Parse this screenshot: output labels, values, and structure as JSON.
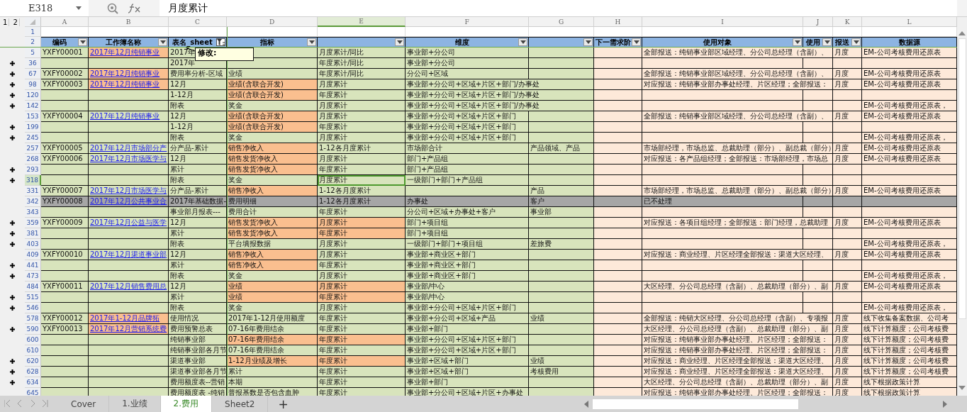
{
  "formula_bar": {
    "cell_name": "E318",
    "value": "月度累计"
  },
  "outline_levels": [
    "1",
    "2"
  ],
  "columns": [
    {
      "letter": "A",
      "header": "编码",
      "filter": true,
      "filter_active": false,
      "selected": false
    },
    {
      "letter": "B",
      "header": "工作簿名称",
      "filter": true,
      "filter_active": false,
      "selected": false
    },
    {
      "letter": "C",
      "header": "表名_sheet",
      "filter": true,
      "filter_active": true,
      "selected": false
    },
    {
      "letter": "D",
      "header": "指标",
      "filter": true,
      "filter_active": false,
      "selected": false
    },
    {
      "letter": "E",
      "filter": true,
      "filter_active": false,
      "selected": true
    },
    {
      "letter": "F",
      "header": "维度",
      "filter": true,
      "filter_active": false,
      "selected": false
    },
    {
      "letter": "G",
      "filter": true,
      "filter_active": false,
      "selected": false
    },
    {
      "letter": "H",
      "header": "下一需求阶",
      "filter": true,
      "filter_active": false,
      "selected": false
    },
    {
      "letter": "I",
      "header": "使用对象",
      "filter": true,
      "filter_active": false,
      "selected": false
    },
    {
      "letter": "J",
      "header": "使用",
      "filter": true,
      "filter_active": false,
      "selected": false
    },
    {
      "letter": "K",
      "header": "报送",
      "filter": true,
      "filter_active": false,
      "selected": false
    },
    {
      "letter": "L",
      "header": "数据源",
      "filter": false,
      "selected": false
    }
  ],
  "title_row_number": "1",
  "header_row_number": "2",
  "rows": [
    {
      "row": "5",
      "expand": false,
      "selected": false,
      "kind": "normal",
      "highlight": {
        "B": true
      },
      "cells": {
        "A": "YXFY00001",
        "B": "2017年12月纯销事业",
        "C": "2017年",
        "E": "月度累计/同比",
        "F": "事业部+分公司",
        "I": "全部报送：纯销事业部区域经理、分公司总经理（含副）、",
        "K": "月度",
        "L": "EM-公司考核费用还原表"
      }
    },
    {
      "row": "36",
      "expand": true,
      "selected": false,
      "kind": "normal",
      "highlight": {},
      "cells": {
        "C": "2017年",
        "E": "年度累计/同比",
        "F": "事业部+分公司"
      }
    },
    {
      "row": "67",
      "expand": true,
      "selected": false,
      "kind": "normal",
      "highlight": {
        "B": true
      },
      "cells": {
        "A": "YXFY00002",
        "B": "2017年12月纯销事业",
        "C": "费用率分析-区域",
        "D": "业绩",
        "E": "年度累计/同比",
        "F": "分公司+区域",
        "I": "全部报送：纯销事业部区域经理、分公司总经理（含副）、",
        "K": "月度",
        "L": "EM-公司考核费用还原表"
      }
    },
    {
      "row": "98",
      "expand": true,
      "selected": false,
      "kind": "normal",
      "highlight": {
        "B": true,
        "D": true
      },
      "cells": {
        "A": "YXFY00003",
        "B": "2017年12月纯销事业",
        "C": "12月",
        "D": "业绩(含联合开发)",
        "E": "月度累计",
        "F": "事业部+分公司+区域+片区+部门/办事处",
        "I": "对应报送：纯销事业部办事处经理、片区经理；全部报送：",
        "K": "月度",
        "L": "EM-公司考核费用还原表"
      }
    },
    {
      "row": "120",
      "expand": true,
      "selected": false,
      "kind": "normal",
      "highlight": {
        "D": true
      },
      "cells": {
        "C": "1-12月",
        "D": "业绩(含联合开发)",
        "E": "年度累计",
        "F": "事业部+分公司+区域+片区+部门/办事处"
      }
    },
    {
      "row": "142",
      "expand": true,
      "selected": false,
      "kind": "normal",
      "highlight": {},
      "cells": {
        "C": "附表",
        "D": "奖金",
        "E": "月度累计",
        "F": "事业部+分公司+区域+片区+部门/办事处",
        "L": "EM-公司考核费用还原表，"
      }
    },
    {
      "row": "153",
      "expand": false,
      "selected": false,
      "kind": "normal",
      "highlight": {
        "D": true
      },
      "cells": {
        "A": "YXFY00004",
        "B": "2017年12月纯销事业",
        "C": "12月",
        "D": "业绩(含联合开发)",
        "E": "月度累计",
        "F": "事业部+分公司+区域+片区+部门",
        "I": "全部报送：纯销事业部区域经理、分公司总经理（含副）、",
        "K": "月度",
        "L": "EM-公司考核费用还原表"
      }
    },
    {
      "row": "199",
      "expand": true,
      "selected": false,
      "kind": "normal",
      "highlight": {
        "D": true
      },
      "cells": {
        "C": "1-12月",
        "D": "业绩(含联合开发)",
        "E": "年度累计",
        "F": "事业部+分公司+区域+片区+部门"
      }
    },
    {
      "row": "245",
      "expand": true,
      "selected": false,
      "kind": "normal",
      "highlight": {},
      "cells": {
        "C": "附表",
        "D": "奖金",
        "E": "月度累计",
        "F": "事业部+分公司+区域+片区+部门",
        "L": "EM-公司考核费用还原表，"
      }
    },
    {
      "row": "257",
      "expand": false,
      "selected": false,
      "kind": "normal",
      "highlight": {
        "D": true
      },
      "cells": {
        "A": "YXFY00005",
        "B": "2017年12月市场部分产",
        "C": "分产品-累计",
        "D": "销售净收入",
        "E": "1-12各月度累计",
        "F": "市场部合计",
        "G": "产品领域、产品",
        "I": "市场部经理，市场总监、总裁助理（部分）、副总裁（部分）",
        "K": "月度",
        "L": "EM-公司考核费用还原表"
      }
    },
    {
      "row": "268",
      "expand": false,
      "selected": false,
      "kind": "normal",
      "highlight": {
        "D": true
      },
      "cells": {
        "A": "YXFY00006",
        "B": "2017年12月市场医学与",
        "C": "12月",
        "D": "销售发货净收入",
        "E": "月度累计",
        "F": "部门+产品组",
        "I": "对应报送：各产品组经理；全部报送：市场部经理，市场总",
        "K": "月度",
        "L": "EM-公司考核费用还原表"
      }
    },
    {
      "row": "293",
      "expand": true,
      "selected": false,
      "kind": "normal",
      "highlight": {
        "D": true
      },
      "cells": {
        "C": "累计",
        "D": "销售发货净收入",
        "E": "年度累计",
        "F": "部门+产品组"
      }
    },
    {
      "row": "318",
      "expand": true,
      "selected": true,
      "kind": "normal",
      "highlight": {},
      "cells": {
        "C": "附表",
        "D": "奖金",
        "E": "月度累计",
        "F": "一级部门+部门+产品组"
      }
    },
    {
      "row": "331",
      "expand": false,
      "selected": false,
      "kind": "normal",
      "highlight": {
        "D": true
      },
      "cells": {
        "A": "YXFY00007",
        "B": "2017年12月市场医学与",
        "C": "分产品-累计",
        "D": "销售净收入",
        "E": "1-12各月度累计",
        "G": "产品",
        "I": "市场部经理，市场总监、总裁助理（部分）、副总裁（部分）",
        "K": "月度",
        "L": "EM-公司考核费用还原表"
      }
    },
    {
      "row": "342",
      "expand": false,
      "selected": false,
      "kind": "gray",
      "highlight": {},
      "cells": {
        "A": "YXFY00008",
        "B": "2017年12月公共事业合",
        "C": "2017年基础数据-",
        "D": "费用明细",
        "E": "1-12各月度累计",
        "F": "办事处",
        "G": "客户",
        "I": "已不处理"
      }
    },
    {
      "row": "343",
      "expand": false,
      "selected": false,
      "kind": "normal",
      "highlight": {},
      "cells": {
        "C": "事业部月报表---",
        "D": "费用合计",
        "E": "年度累计",
        "F": "分公司+区域+办事处+客户",
        "G": "事业部"
      }
    },
    {
      "row": "359",
      "expand": true,
      "selected": false,
      "kind": "normal",
      "highlight": {
        "D": true,
        "E": true
      },
      "cells": {
        "A": "YXFY00009",
        "B": "2017年12月公益与医学",
        "C": "12月",
        "D": "销售发货净收入",
        "E": "月度累计",
        "F": "部门+项目组",
        "I": "对应报送：各项目组经理；全部报送：部门经理，总裁助理",
        "K": "月度",
        "L": "EM-公司考核费用还原表"
      }
    },
    {
      "row": "381",
      "expand": true,
      "selected": false,
      "kind": "normal",
      "highlight": {
        "D": true,
        "E": true
      },
      "cells": {
        "C": "累计",
        "D": "销售发货净收入",
        "E": "年度累计",
        "F": "部门+项目组"
      }
    },
    {
      "row": "403",
      "expand": true,
      "selected": false,
      "kind": "normal",
      "highlight": {},
      "cells": {
        "C": "附表",
        "D": "平台填报数据",
        "E": "月度累计",
        "F": "一级部门+部门+项目组",
        "G": "差旅费",
        "L": "EM-公司考核费用还原表，"
      }
    },
    {
      "row": "409",
      "expand": false,
      "selected": false,
      "kind": "normal",
      "highlight": {
        "D": true
      },
      "cells": {
        "A": "YXFY00010",
        "B": "2017年12月渠道事业部",
        "C": "12月",
        "D": "销售净收入",
        "E": "月度累计",
        "F": "事业部+商业区+部门",
        "I": "对应报送：商业经理、片区经理全部报送：渠道大区经理、",
        "K": "月度",
        "L": "EM-公司考核费用还原表"
      }
    },
    {
      "row": "441",
      "expand": true,
      "selected": false,
      "kind": "normal",
      "highlight": {
        "D": true
      },
      "cells": {
        "C": "累计",
        "D": "销售净收入",
        "E": "年度累计",
        "F": "事业部+商业区+部门"
      }
    },
    {
      "row": "473",
      "expand": true,
      "selected": false,
      "kind": "normal",
      "highlight": {},
      "cells": {
        "C": "附表",
        "D": "奖金",
        "E": "月度累计",
        "F": "事业部+商业区+部门",
        "L": "EM-公司考核费用还原表，"
      }
    },
    {
      "row": "484",
      "expand": false,
      "selected": false,
      "kind": "normal",
      "highlight": {
        "D": true,
        "E": true
      },
      "cells": {
        "A": "YXFY00011",
        "B": "2017年12月销售费用总",
        "C": "12月",
        "D": "业绩",
        "E": "月度累计",
        "F": "事业部/中心",
        "I": "大区经理、分公司总经理（含副）、总裁助理（部分）、副",
        "K": "月度",
        "L": "EM-公司考核费用还原表"
      }
    },
    {
      "row": "515",
      "expand": true,
      "selected": false,
      "kind": "normal",
      "highlight": {
        "D": true,
        "E": true
      },
      "cells": {
        "C": "累计",
        "D": "业绩",
        "E": "年度累计",
        "F": "事业部/中心"
      }
    },
    {
      "row": "546",
      "expand": true,
      "selected": false,
      "kind": "normal",
      "highlight": {},
      "cells": {
        "C": "附表",
        "D": "奖金",
        "E": "月度累计",
        "F": "事业部+分公司+区域+片区+部门",
        "L": "EM-公司考核费用还原表，"
      }
    },
    {
      "row": "578",
      "expand": false,
      "selected": false,
      "kind": "normal",
      "highlight": {
        "B": true
      },
      "cells": {
        "A": "YXFY00012",
        "B": "2017年1-12月品牌拓",
        "C": "使用情况",
        "D": "2017年1-12月使用额度",
        "E": "年度累计",
        "F": "事业部+分公司+区域+产品",
        "G": "业绩",
        "I": "全部报送：纯销大区经理、分公司总经理（含副）、专项报",
        "K": "月度",
        "L": "线下收集备案数据、公司考"
      }
    },
    {
      "row": "590",
      "expand": true,
      "selected": false,
      "kind": "normal",
      "highlight": {
        "B": true
      },
      "cells": {
        "A": "YXFY00013",
        "B": "2017年12月营销系统费",
        "C": "费用预警总表",
        "D": "07-16年费用结余",
        "E": "年度累计",
        "F": "事业部+部门",
        "I": "大区经理、分公司总经理（含副）、总裁助理（部分）、副",
        "K": "月度",
        "L": "线下计算额度；公司考核费"
      }
    },
    {
      "row": "600",
      "expand": false,
      "selected": false,
      "kind": "normal",
      "highlight": {
        "D": true,
        "E": true
      },
      "cells": {
        "C": "纯销事业部",
        "D": "07-16年费用结余",
        "E": "年度累计",
        "F": "事业部+分公司+区域+片区+部门",
        "I": "对应报送：纯销事业部办事处经理、片区经理；全部报送：",
        "K": "月度",
        "L": "线下计算额度；公司考核费"
      }
    },
    {
      "row": "610",
      "expand": false,
      "selected": false,
      "kind": "normal",
      "highlight": {},
      "cells": {
        "C": "纯销事业部各月节",
        "D": "07-16年费用结余",
        "E": "年度累计",
        "F": "事业部+分公司+区域+片区+部门",
        "I": "对应报送：纯销事业部办事处经理、片区经理；全部报送：",
        "K": "月度",
        "L": "线下计算额度；公司考核费"
      }
    },
    {
      "row": "620",
      "expand": true,
      "selected": false,
      "kind": "normal",
      "highlight": {
        "D": true,
        "E": true
      },
      "cells": {
        "C": "渠道事业部",
        "D": "1-12月业绩及增长",
        "E": "年度累计",
        "F": "事业部+区域+部门",
        "G": "业绩",
        "I": "对应报送：商业经理、片区经理全部报送：渠道大区经理、",
        "K": "月度",
        "L": "线下计算额度；公司考核费"
      }
    },
    {
      "row": "628",
      "expand": true,
      "selected": false,
      "kind": "normal",
      "highlight": {},
      "cells": {
        "C": "渠道事业部各月节",
        "D": "累计",
        "E": "年度累计",
        "F": "事业部+区域+部门",
        "G": "考核费用",
        "I": "对应报送：商业经理、片区经理全部报送：渠道大区经理、",
        "K": "月度",
        "L": "线下计算额度；公司考核费"
      }
    },
    {
      "row": "634",
      "expand": true,
      "selected": false,
      "kind": "normal",
      "highlight": {},
      "cells": {
        "C": "费用额度表--营销",
        "D": "本期",
        "E": "年度累计",
        "F": "事业部+部门",
        "I": "大区经理、分公司总经理（含副）、总裁助理（部分）、副",
        "K": "月度",
        "L": "线下根据政策计算"
      }
    },
    {
      "row": "645",
      "expand": false,
      "selected": false,
      "kind": "normal",
      "highlight": {},
      "cells": {
        "C": "费用额度表 -纯销",
        "D": "普报基数是否包含血肿",
        "E": "年度累计",
        "F": "事业部+分公司+区域+片区+办事处",
        "I": "对应报送：纯销事业部办事处经理、片区经理；全部报送：",
        "K": "月度",
        "L": "线下根据政策计算"
      }
    }
  ],
  "comment": {
    "text": "修改:"
  },
  "sheet_tabs": [
    {
      "label": "Cover",
      "selected": false
    },
    {
      "label": "1.业绩",
      "selected": false
    },
    {
      "label": "2.费用",
      "selected": true
    },
    {
      "label": "Sheet2",
      "selected": false
    }
  ],
  "add_sheet": "+"
}
